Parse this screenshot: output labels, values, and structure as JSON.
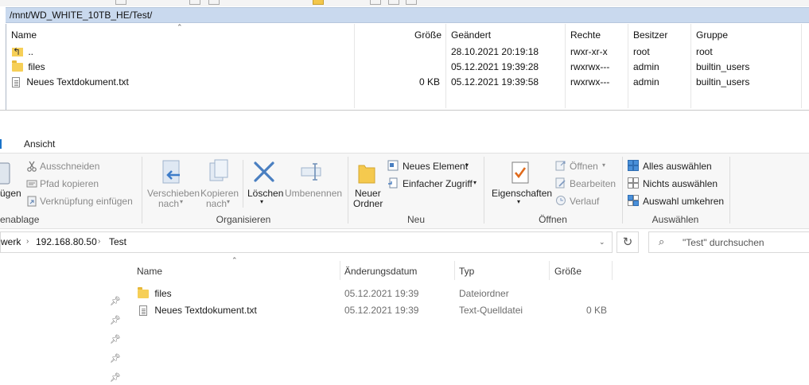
{
  "remote_panel": {
    "path": "/mnt/WD_WHITE_10TB_HE/Test/",
    "columns": {
      "name": "Name",
      "size": "Größe",
      "modified": "Geändert",
      "rights": "Rechte",
      "owner": "Besitzer",
      "group": "Gruppe"
    },
    "rows": [
      {
        "name": "..",
        "icon": "parent-folder-icon",
        "size": "",
        "modified": "28.10.2021 20:19:18",
        "rights": "rwxr-xr-x",
        "owner": "root",
        "group": "root"
      },
      {
        "name": "files",
        "icon": "folder-icon",
        "size": "",
        "modified": "05.12.2021 19:39:28",
        "rights": "rwxrwx---",
        "owner": "admin",
        "group": "builtin_users"
      },
      {
        "name": "Neues Textdokument.txt",
        "icon": "text-file-icon",
        "size": "0 KB",
        "modified": "05.12.2021 19:39:58",
        "rights": "rwxrwx---",
        "owner": "admin",
        "group": "builtin_users"
      }
    ]
  },
  "explorer": {
    "tabs": {
      "view": "Ansicht"
    },
    "ribbon": {
      "clipboard": {
        "paste_partial": "ügen",
        "group_partial": "enablage",
        "cut": "Ausschneiden",
        "copy_path": "Pfad kopieren",
        "paste_shortcut": "Verknüpfung einfügen"
      },
      "organize": {
        "move_to_1": "Verschieben",
        "move_to_2": "nach",
        "copy_to_1": "Kopieren",
        "copy_to_2": "nach",
        "delete": "Löschen",
        "rename": "Umbenennen",
        "group": "Organisieren"
      },
      "new": {
        "new_folder_1": "Neuer",
        "new_folder_2": "Ordner",
        "new_item": "Neues Element",
        "easy_access": "Einfacher Zugriff",
        "group": "Neu"
      },
      "open": {
        "properties": "Eigenschaften",
        "open": "Öffnen",
        "edit": "Bearbeiten",
        "history": "Verlauf",
        "group": "Öffnen"
      },
      "select": {
        "select_all": "Alles auswählen",
        "select_none": "Nichts auswählen",
        "invert": "Auswahl umkehren",
        "group": "Auswählen"
      }
    },
    "address": {
      "crumb_partial": "werk",
      "crumb_host": "192.168.80.50",
      "crumb_folder": "Test"
    },
    "search": {
      "placeholder": "\"Test\" durchsuchen"
    },
    "columns": {
      "name": "Name",
      "date": "Änderungsdatum",
      "type": "Typ",
      "size": "Größe"
    },
    "rows": [
      {
        "name": "files",
        "icon": "folder-icon",
        "date": "05.12.2021 19:39",
        "type": "Dateiordner",
        "size": ""
      },
      {
        "name": "Neues Textdokument.txt",
        "icon": "text-file-icon",
        "date": "05.12.2021 19:39",
        "type": "Text-Quelldatei",
        "size": "0 KB"
      }
    ]
  }
}
